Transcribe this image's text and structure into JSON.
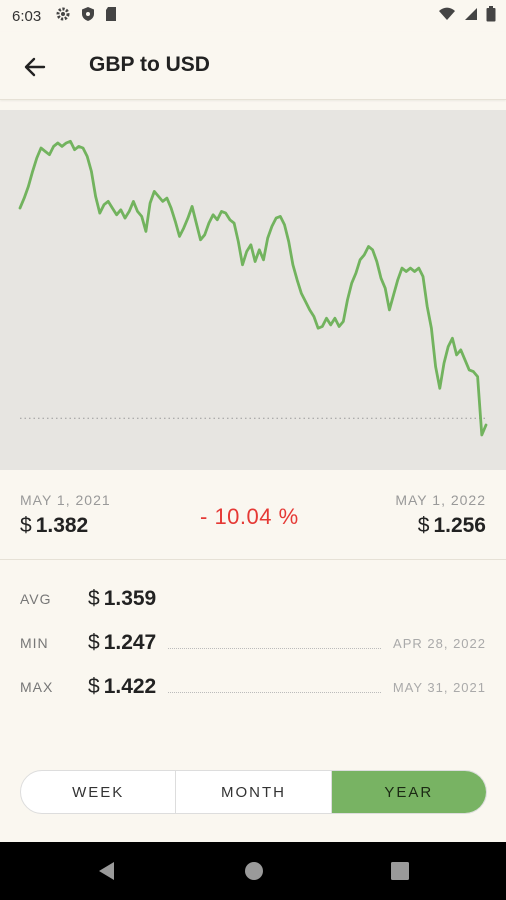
{
  "status_bar": {
    "time": "6:03"
  },
  "app_bar": {
    "title": "GBP to USD"
  },
  "chart_data": {
    "type": "line",
    "color": "#72b35e",
    "baseline": 1.256,
    "start_label": "MAY 1, 2021",
    "end_label": "MAY 1, 2022",
    "ylim": [
      1.24,
      1.43
    ],
    "values": [
      1.382,
      1.388,
      1.395,
      1.404,
      1.412,
      1.418,
      1.416,
      1.414,
      1.419,
      1.421,
      1.419,
      1.421,
      1.422,
      1.417,
      1.419,
      1.418,
      1.413,
      1.404,
      1.389,
      1.379,
      1.384,
      1.386,
      1.382,
      1.378,
      1.381,
      1.376,
      1.38,
      1.386,
      1.38,
      1.377,
      1.368,
      1.385,
      1.392,
      1.389,
      1.386,
      1.388,
      1.382,
      1.374,
      1.365,
      1.37,
      1.376,
      1.383,
      1.373,
      1.363,
      1.366,
      1.373,
      1.378,
      1.375,
      1.38,
      1.379,
      1.375,
      1.373,
      1.362,
      1.348,
      1.356,
      1.36,
      1.35,
      1.357,
      1.351,
      1.364,
      1.371,
      1.376,
      1.377,
      1.372,
      1.362,
      1.348,
      1.339,
      1.331,
      1.326,
      1.321,
      1.317,
      1.31,
      1.311,
      1.316,
      1.312,
      1.316,
      1.311,
      1.314,
      1.327,
      1.337,
      1.343,
      1.351,
      1.354,
      1.359,
      1.357,
      1.35,
      1.34,
      1.334,
      1.321,
      1.33,
      1.339,
      1.346,
      1.344,
      1.346,
      1.344,
      1.346,
      1.341,
      1.323,
      1.31,
      1.287,
      1.274,
      1.289,
      1.299,
      1.304,
      1.294,
      1.297,
      1.291,
      1.285,
      1.284,
      1.281,
      1.246,
      1.252
    ]
  },
  "summary": {
    "start_date": "MAY 1, 2021",
    "start_currency": "$",
    "start_value": "1.382",
    "change": "- 10.04 %",
    "end_date": "MAY 1, 2022",
    "end_currency": "$",
    "end_value": "1.256"
  },
  "stats": {
    "avg": {
      "label": "AVG",
      "currency": "$",
      "value": "1.359"
    },
    "min": {
      "label": "MIN",
      "currency": "$",
      "value": "1.247",
      "date": "APR 28, 2022"
    },
    "max": {
      "label": "MAX",
      "currency": "$",
      "value": "1.422",
      "date": "MAY 31, 2021"
    }
  },
  "range_toggle": {
    "options": [
      "WEEK",
      "MONTH",
      "YEAR"
    ],
    "selected": "YEAR",
    "active_color": "#78b363"
  }
}
